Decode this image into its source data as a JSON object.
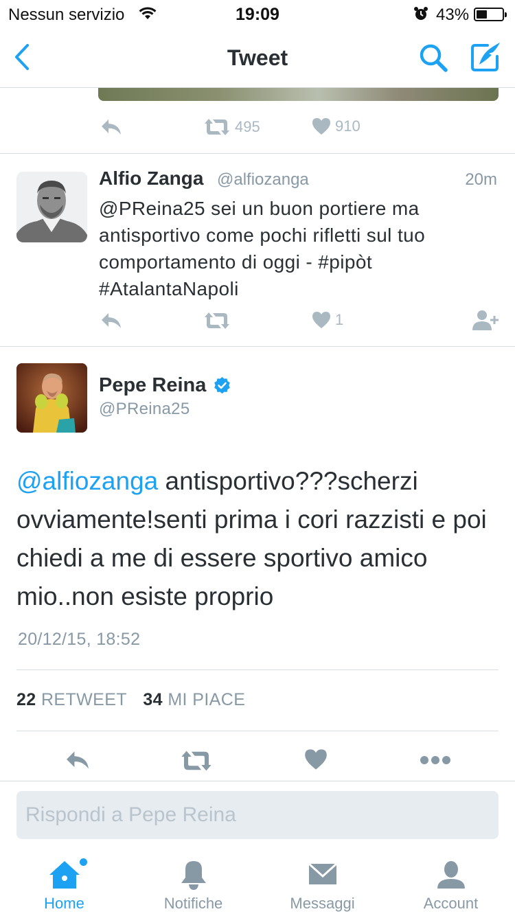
{
  "status_bar": {
    "carrier": "Nessun servizio",
    "time": "19:09",
    "battery_percent": "43%",
    "battery_level": 0.43,
    "icons": [
      "wifi-icon",
      "alarm-icon",
      "battery-icon"
    ]
  },
  "nav": {
    "title": "Tweet",
    "back_icon": "chevron-left-icon",
    "search_icon": "search-icon",
    "compose_icon": "compose-icon"
  },
  "previous_tweet": {
    "retweets": "495",
    "likes": "910"
  },
  "reply_tweet": {
    "name": "Alfio Zanga",
    "handle": "@alfiozanga",
    "time": "20m",
    "text_lines": [
      "@PReina25 sei un buon portiere ma",
      "antisportivo come pochi rifletti sul tuo",
      "comportamento di oggi - #pipòt",
      "#AtalantaNapoli"
    ],
    "likes": "1"
  },
  "main_tweet": {
    "name": "Pepe Reina",
    "verified": true,
    "handle": "@PReina25",
    "mention": "@alfiozanga",
    "text_rest": " antisportivo???scherzi ovviamente!senti prima i cori razzisti e poi chiedi a me di essere sportivo amico mio..non esiste proprio",
    "date": "20/12/15, 18:52",
    "retweet_count": "22",
    "retweet_label": "RETWEET",
    "like_count": "34",
    "like_label": "MI PIACE"
  },
  "reply_box": {
    "placeholder": "Rispondi a Pepe Reina"
  },
  "tabs": [
    {
      "label": "Home",
      "icon": "home-icon",
      "active": true
    },
    {
      "label": "Notifiche",
      "icon": "bell-icon",
      "active": false
    },
    {
      "label": "Messaggi",
      "icon": "envelope-icon",
      "active": false
    },
    {
      "label": "Account",
      "icon": "person-icon",
      "active": false
    }
  ],
  "colors": {
    "accent": "#1da1f2",
    "muted": "#aab8c2",
    "text": "#292f33",
    "secondary": "#8899a6"
  }
}
